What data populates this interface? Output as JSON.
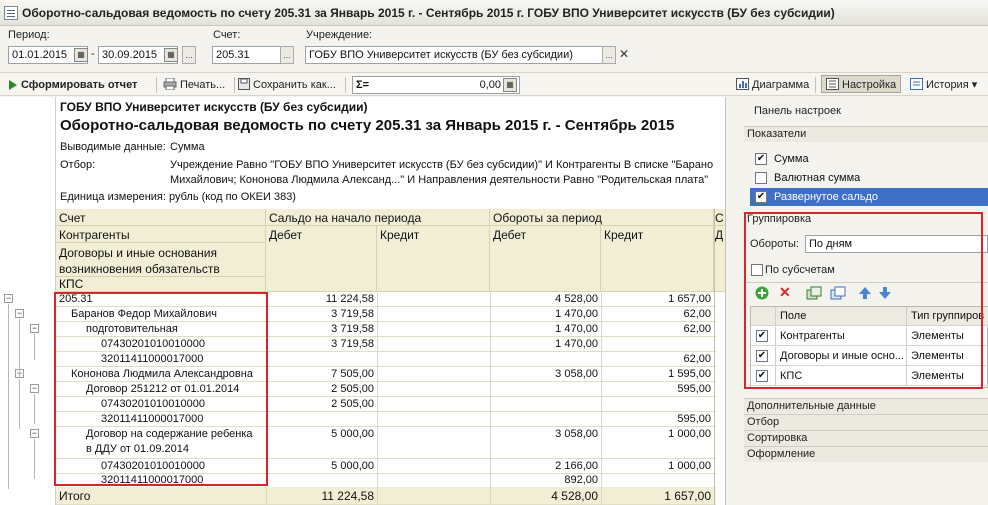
{
  "window": {
    "title": "Оборотно-сальдовая ведомость по счету 205.31 за Январь 2015 г. - Сентябрь 2015 г. ГОБУ ВПО Университет искусств (БУ без субсидии)"
  },
  "params": {
    "period_label": "Период:",
    "date_from": "01.01.2015",
    "date_to": "30.09.2015",
    "dash": "-",
    "calc_btn": "...",
    "account_label": "Счет:",
    "account_value": "205.31",
    "org_label": "Учреждение:",
    "org_value": "ГОБУ ВПО Университет искусств (БУ без субсидии)",
    "clear_btn": "✕"
  },
  "toolbar": {
    "generate": "Сформировать отчет",
    "print": "Печать...",
    "save": "Сохранить как...",
    "sum_value": "0,00",
    "diagram": "Диаграмма",
    "settings": "Настройка",
    "history": "История"
  },
  "report": {
    "org": "ГОБУ ВПО Университет искусств (БУ без субсидии)",
    "title": "Оборотно-сальдовая ведомость по счету 205.31 за Январь 2015 г. - Сентябрь 2015",
    "output_label": "Выводимые данные:",
    "output_value": "Сумма",
    "filter_label": "Отбор:",
    "filter_line1": "Учреждение Равно \"ГОБУ ВПО Университет искусств (БУ без субсидии)\" И Контрагенты В списке \"Барано",
    "filter_line2": "Михайлович; Кононова Людмила Александ...\" И Направления деятельности Равно \"Родительская плата\"",
    "unit": "Единица измерения: рубль (код по ОКЕИ 383)",
    "headers": {
      "account": "Счет",
      "counterparties": "Контрагенты",
      "contracts_line1": "Договоры и иные основания",
      "contracts_line2": "возникновения обязательств",
      "kps": "КПС",
      "opening": "Сальдо на начало периода",
      "turnover": "Обороты за период",
      "debit1": "Дебет",
      "credit1": "Кредит",
      "debit2": "Дебет",
      "credit2": "Кредит",
      "cut_c": "С",
      "cut_d": "Д"
    },
    "rows": [
      {
        "name": "205.31",
        "indent": 0,
        "d1": "11 224,58",
        "c1": "",
        "d2": "4 528,00",
        "c2": "1 657,00"
      },
      {
        "name": "Баранов Федор Михайлович",
        "indent": 1,
        "d1": "3 719,58",
        "c1": "",
        "d2": "1 470,00",
        "c2": "62,00"
      },
      {
        "name": "подготовительная",
        "indent": 2,
        "d1": "3 719,58",
        "c1": "",
        "d2": "1 470,00",
        "c2": "62,00"
      },
      {
        "name": "07430201010010000",
        "indent": 3,
        "d1": "3 719,58",
        "c1": "",
        "d2": "1 470,00",
        "c2": ""
      },
      {
        "name": "32011411000017000",
        "indent": 3,
        "d1": "",
        "c1": "",
        "d2": "",
        "c2": "62,00"
      },
      {
        "name": "Кононова Людмила Александровна",
        "indent": 1,
        "d1": "7 505,00",
        "c1": "",
        "d2": "3 058,00",
        "c2": "1 595,00"
      },
      {
        "name": "Договор 251212  от 01.01.2014",
        "indent": 2,
        "d1": "2 505,00",
        "c1": "",
        "d2": "",
        "c2": "595,00"
      },
      {
        "name": "07430201010010000",
        "indent": 3,
        "d1": "2 505,00",
        "c1": "",
        "d2": "",
        "c2": ""
      },
      {
        "name": "32011411000017000",
        "indent": 3,
        "d1": "",
        "c1": "",
        "d2": "",
        "c2": "595,00"
      }
    ],
    "contract_row": {
      "line1": "Договор на содержание ребенка",
      "line2": "в ДДУ  от 01.09.2014",
      "d1": "5 000,00",
      "d2": "3 058,00",
      "c2": "1 000,00"
    },
    "rows_after": [
      {
        "name": "07430201010010000",
        "d1": "5 000,00",
        "d2": "2 166,00",
        "c2": "1 000,00"
      },
      {
        "name": "32011411000017000",
        "d1": "",
        "d2": "892,00",
        "c2": ""
      }
    ],
    "total": {
      "label": "Итого",
      "d1": "11 224,58",
      "c1": "",
      "d2": "4 528,00",
      "c2": "1 657,00"
    }
  },
  "panel": {
    "title": "Панель настроек",
    "indicators": "Показатели",
    "ind_items": [
      {
        "label": "Сумма",
        "checked": true
      },
      {
        "label": "Валютная сумма",
        "checked": false
      },
      {
        "label": "Развернутое сальдо",
        "checked": true
      }
    ],
    "grouping": "Группировка",
    "turnovers_label": "Обороты:",
    "turnovers_value": "По дням",
    "by_subaccounts": "По субсчетам",
    "grid_headers": {
      "field": "Поле",
      "type": "Тип группиров"
    },
    "grid_rows": [
      {
        "field": "Контрагенты",
        "type": "Элементы"
      },
      {
        "field": "Договоры и иные осно...",
        "type": "Элементы"
      },
      {
        "field": "КПС",
        "type": "Элементы"
      }
    ],
    "additional": "Дополнительные данные",
    "filter": "Отбор",
    "sort": "Сортировка",
    "design": "Оформление"
  },
  "colors": {
    "header_bg": "#f2eed6",
    "highlight": "#d9252a",
    "selected": "#3f6fc7"
  }
}
